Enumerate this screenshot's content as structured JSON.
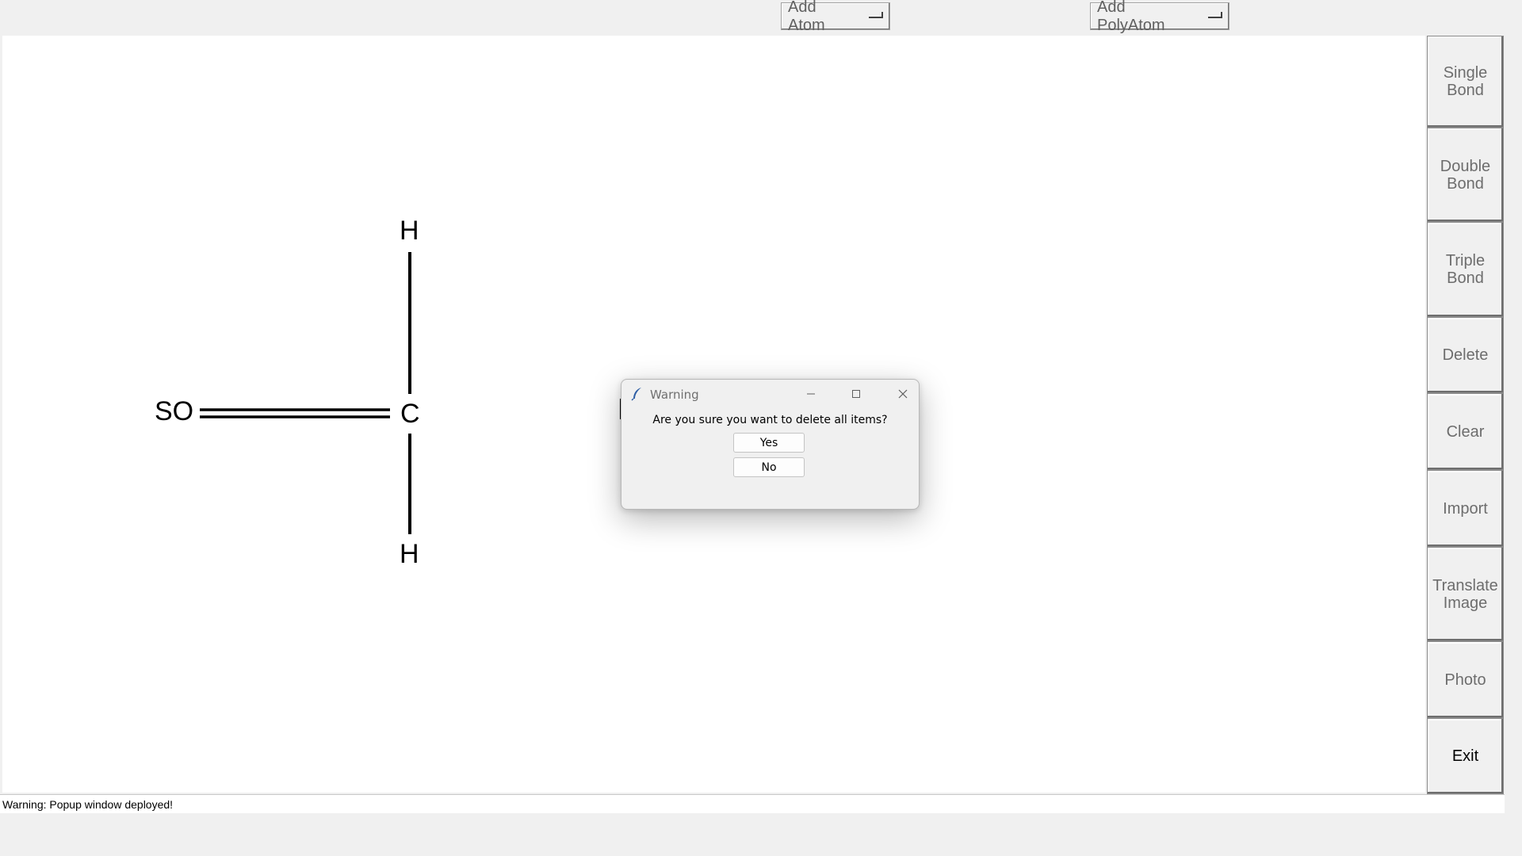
{
  "toolbar": {
    "add_atom_label": "Add Atom",
    "add_polyatom_label": "Add PolyAtom"
  },
  "sidebar": {
    "items": [
      {
        "label": "Single\nBond"
      },
      {
        "label": "Double\nBond"
      },
      {
        "label": "Triple\nBond"
      },
      {
        "label": "Delete"
      },
      {
        "label": "Clear"
      },
      {
        "label": "Import"
      },
      {
        "label": "Translate\nImage"
      },
      {
        "label": "Photo"
      },
      {
        "label": "Exit"
      }
    ]
  },
  "canvas": {
    "atoms": {
      "so": "SO",
      "c": "C",
      "h_top": "H",
      "h_bottom": "H"
    }
  },
  "dialog": {
    "title": "Warning",
    "message": "Are you sure you want to delete all items?",
    "yes_label": "Yes",
    "no_label": "No"
  },
  "status": {
    "text": "Warning: Popup window deployed!"
  },
  "icons": {
    "dialog_app_icon": "feather-icon",
    "minimize": "minimize-icon",
    "maximize": "maximize-icon",
    "close": "close-icon"
  }
}
